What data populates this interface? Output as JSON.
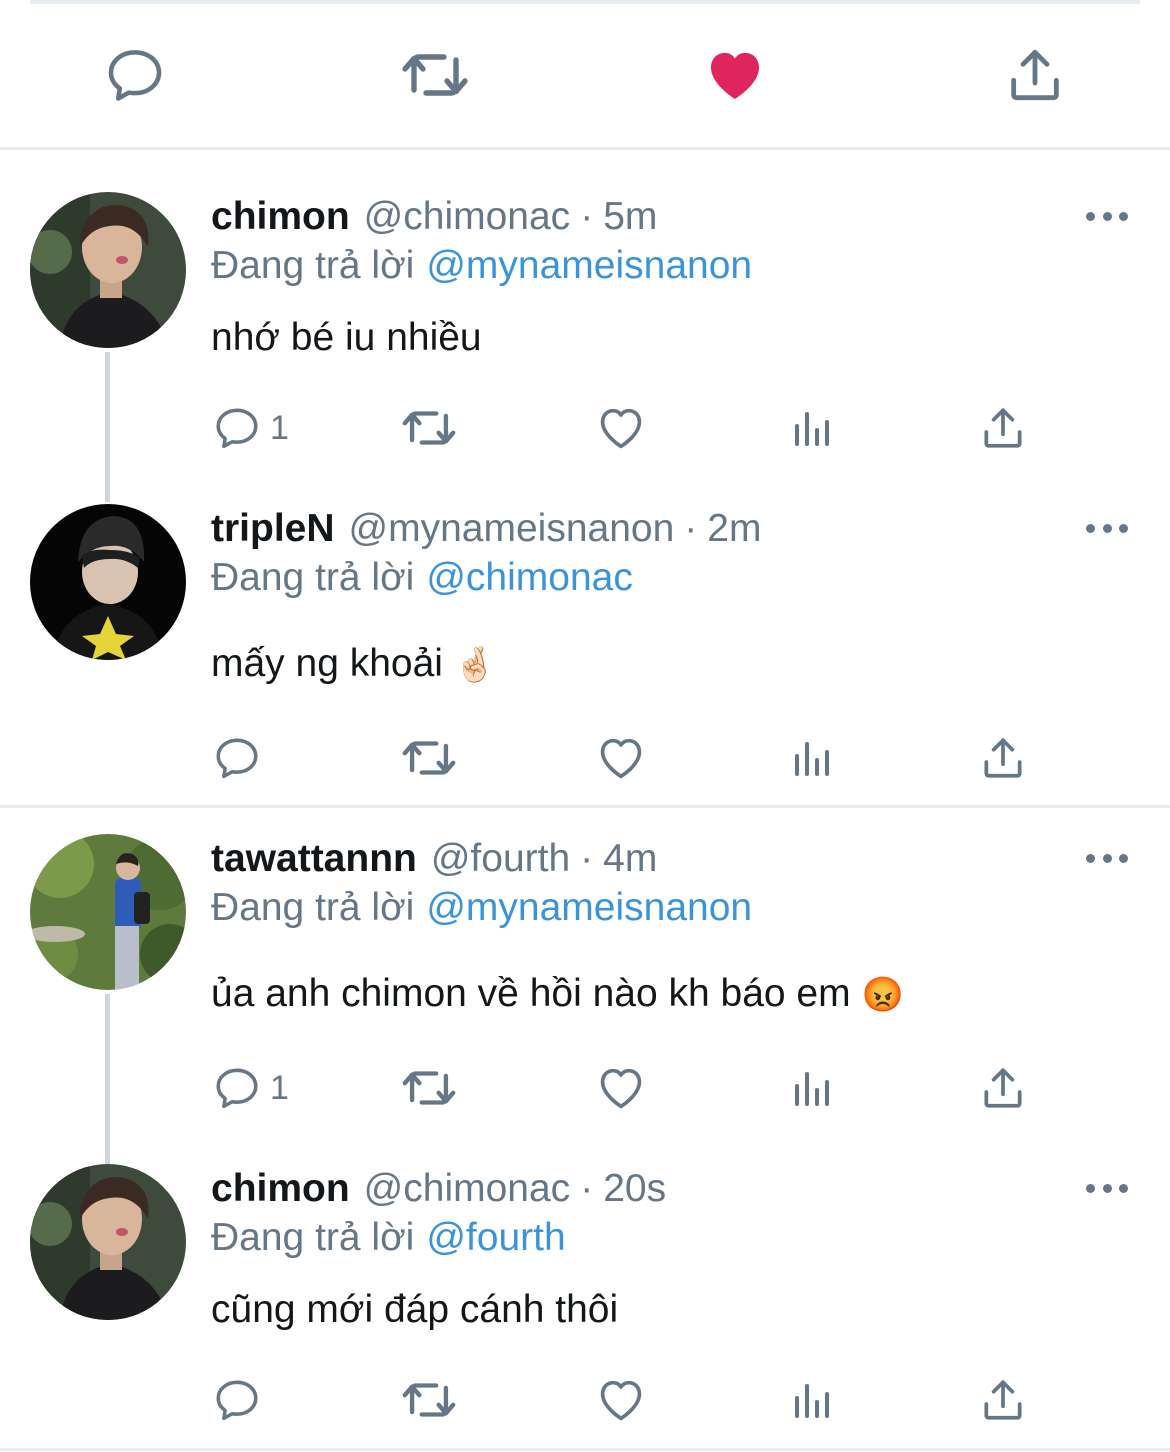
{
  "main_actions": {
    "icons": [
      "reply-icon",
      "retweet-icon",
      "like-filled-icon",
      "share-icon"
    ],
    "liked_color": "#e0245e"
  },
  "colors": {
    "text": "#14171a",
    "secondary": "#657786",
    "mention": "#3b94d9",
    "separator": "#e6ecf0",
    "thread_line": "#ccd6dd"
  },
  "tweets": [
    {
      "name": "chimon",
      "handle": "@chimonac",
      "time": "5m",
      "reply_prefix": "Đang trả lời",
      "reply_to": "@mynameisnanon",
      "text": "nhớ bé iu nhiều",
      "reply_count": "1",
      "avatar": "avatar-chimon"
    },
    {
      "name": "tripleN",
      "handle": "@mynameisnanon",
      "time": "2m",
      "reply_prefix": "Đang trả lời",
      "reply_to": "@chimonac",
      "text": "mấy ng khoải",
      "emoji": "🤞🏻",
      "reply_count": "",
      "avatar": "avatar-triplen"
    },
    {
      "name": "tawattannn",
      "handle": "@fourth",
      "time": "4m",
      "reply_prefix": "Đang trả lời",
      "reply_to": "@mynameisnanon",
      "text": "ủa anh chimon về hồi nào kh báo em",
      "emoji": "😡",
      "reply_count": "1",
      "avatar": "avatar-tawattannn"
    },
    {
      "name": "chimon",
      "handle": "@chimonac",
      "time": "20s",
      "reply_prefix": "Đang trả lời",
      "reply_to": "@fourth",
      "text": "cũng mới đáp cánh thôi",
      "reply_count": "",
      "avatar": "avatar-chimon"
    }
  ]
}
